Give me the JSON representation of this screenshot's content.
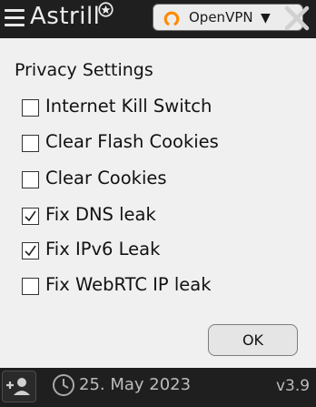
{
  "app": {
    "brand": "Astrill"
  },
  "protocol": {
    "selected": "OpenVPN",
    "caret": "▼"
  },
  "colors": {
    "protocol_icon": "#ff8a00",
    "window_bg": "#1f1f1f",
    "panel_bg": "#f0f0f0"
  },
  "icons": [
    "menu-icon",
    "astrill-star-icon",
    "openvpn-icon",
    "close-icon",
    "checkbox-icon",
    "add-user-icon",
    "clock-icon"
  ],
  "privacy": {
    "title": "Privacy Settings",
    "options": [
      {
        "label": "Internet Kill Switch",
        "checked": false
      },
      {
        "label": "Clear Flash Cookies",
        "checked": false
      },
      {
        "label": "Clear Cookies",
        "checked": false
      },
      {
        "label": "Fix DNS leak",
        "checked": true
      },
      {
        "label": "Fix IPv6 Leak",
        "checked": true
      },
      {
        "label": "Fix WebRTC IP leak",
        "checked": false
      }
    ],
    "ok_label": "OK"
  },
  "footer": {
    "date": "25. May 2023",
    "version": "v3.9"
  }
}
